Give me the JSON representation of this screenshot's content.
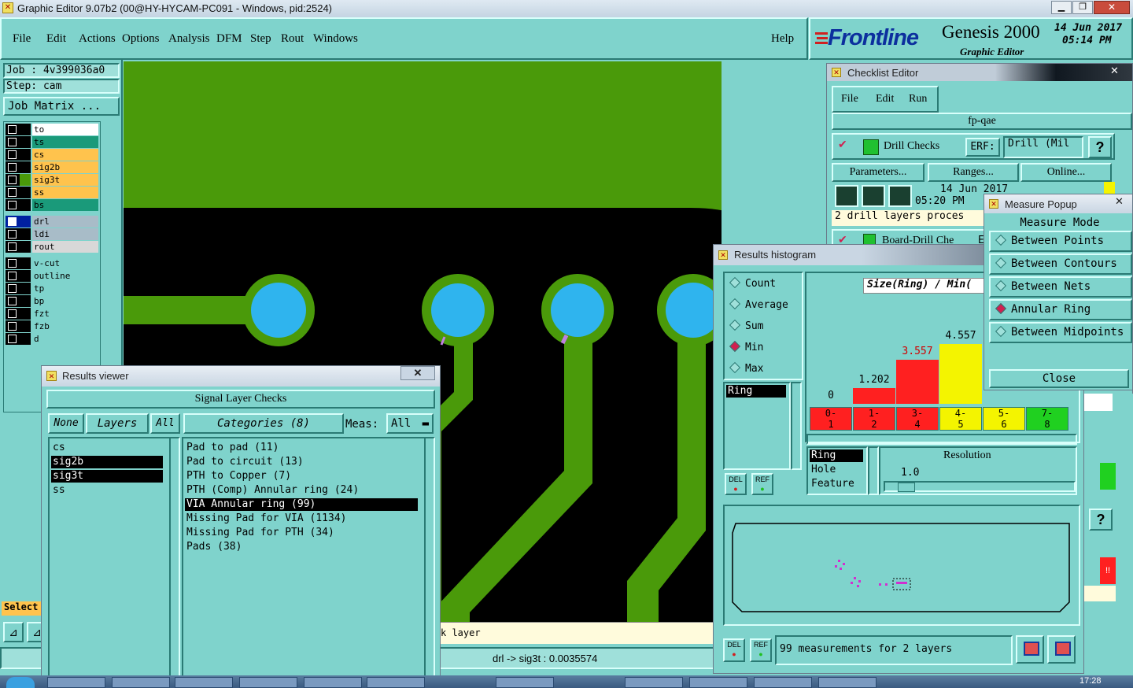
{
  "app": {
    "title": "Graphic Editor 9.07b2 (00@HY-HYCAM-PC091 - Windows, pid:2524)"
  },
  "menu": [
    "File",
    "Edit",
    "Actions",
    "Options",
    "Analysis",
    "DFM",
    "Step",
    "Rout",
    "Windows"
  ],
  "help_label": "Help",
  "brand": {
    "logo": "Frontline",
    "product": "Genesis 2000",
    "subtitle": "Graphic Editor",
    "date": "14 Jun 2017",
    "time": "05:14 PM"
  },
  "job": {
    "job_label": "Job : 4v399036a0",
    "step_label": "Step: cam",
    "matrix_button": "Job Matrix ..."
  },
  "layers": [
    {
      "name": "to",
      "color": "#ffffff"
    },
    {
      "name": "ts",
      "color": "#1a9a7a"
    },
    {
      "name": "cs",
      "color": "#ffc34d"
    },
    {
      "name": "sig2b",
      "color": "#ffc34d"
    },
    {
      "name": "sig3t",
      "color": "#ffc34d"
    },
    {
      "name": "ss",
      "color": "#ffc34d"
    },
    {
      "name": "bs",
      "color": "#1a9a7a"
    },
    {
      "name": "drl",
      "color": "#a8bcc8"
    },
    {
      "name": "ldi",
      "color": "#a8bcc8"
    },
    {
      "name": "rout",
      "color": "#d8d8d8"
    },
    {
      "name": "v-cut",
      "color": "#7fd3cc"
    },
    {
      "name": "outline",
      "color": "#7fd3cc"
    },
    {
      "name": "tp",
      "color": "#7fd3cc"
    },
    {
      "name": "bp",
      "color": "#7fd3cc"
    },
    {
      "name": "fzt",
      "color": "#7fd3cc"
    },
    {
      "name": "fzb",
      "color": "#7fd3cc"
    },
    {
      "name": "d",
      "color": "#7fd3cc"
    }
  ],
  "select_label": "Select",
  "status_bar": {
    "layer_hint": "k layer",
    "measure": "drl -> sig3t : 0.0035574"
  },
  "results_viewer": {
    "title": "Results viewer",
    "header": "Signal Layer Checks",
    "none_label": "None",
    "layers_label": "Layers",
    "all_label": "All",
    "categories_label": "Categories (8)",
    "meas_label": "Meas:",
    "meas_value": "All",
    "layer_list": [
      "cs",
      "sig2b",
      "sig3t",
      "ss"
    ],
    "categories": [
      "Pad to pad (11)",
      "Pad to circuit (13)",
      "PTH to Copper (7)",
      "PTH (Comp) Annular ring (24)",
      "VIA Annular ring (99)",
      "Missing Pad for VIA (1134)",
      "Missing Pad for PTH (34)",
      "Pads (38)"
    ]
  },
  "checklist": {
    "title": "Checklist Editor",
    "menu": [
      "File",
      "Edit",
      "Run"
    ],
    "name": "fp-qae",
    "check1": "Drill Checks",
    "erf_label": "ERF:",
    "erf_value": "Drill (Mil",
    "params_button": "Parameters...",
    "ranges_button": "Ranges...",
    "online_button": "Online...",
    "date": "14 Jun 2017",
    "time": "05:20 PM",
    "status": "2 drill layers proces",
    "check2": "Board-Drill Che",
    "erf2": "ER"
  },
  "histogram": {
    "title": "Results histogram",
    "modes": [
      "Count",
      "Average",
      "Sum",
      "Min",
      "Max"
    ],
    "selected_mode": "Min",
    "header": "Size(Ring) / Min(",
    "attr_list_selected": "Ring",
    "del_label": "DEL",
    "ref_label": "REF",
    "bins": [
      {
        "label": "0-\n1",
        "value_text": "0",
        "color": "#ff2020",
        "fill": 0
      },
      {
        "label": "1-\n2",
        "value_text": "1.202",
        "color": "#ff2020",
        "fill": 0.19
      },
      {
        "label": "3-\n4",
        "value_text": "3.557",
        "color": "#ff2020",
        "fill": 0.53
      },
      {
        "label": "4-\n5",
        "value_text": "4.557",
        "color": "#f4f400",
        "fill": 0.72
      },
      {
        "label": "5-\n6",
        "value_text": "",
        "color": "#f4f400",
        "fill": 0
      },
      {
        "label": "7-\n8",
        "value_text": "",
        "color": "#20d020",
        "fill": 0
      }
    ],
    "sort_options": [
      "Ring",
      "Hole",
      "Feature"
    ],
    "resolution_label": "Resolution",
    "resolution_value": "1.0",
    "summary": "99 measurements for 2 layers"
  },
  "measure_popup": {
    "title": "Measure Popup",
    "header": "Measure Mode",
    "options": [
      "Between Points",
      "Between Contours",
      "Between Nets",
      "Annular Ring",
      "Between Midpoints"
    ],
    "selected": "Annular Ring",
    "close_label": "Close"
  },
  "taskbar": {
    "clock": "17:28"
  }
}
